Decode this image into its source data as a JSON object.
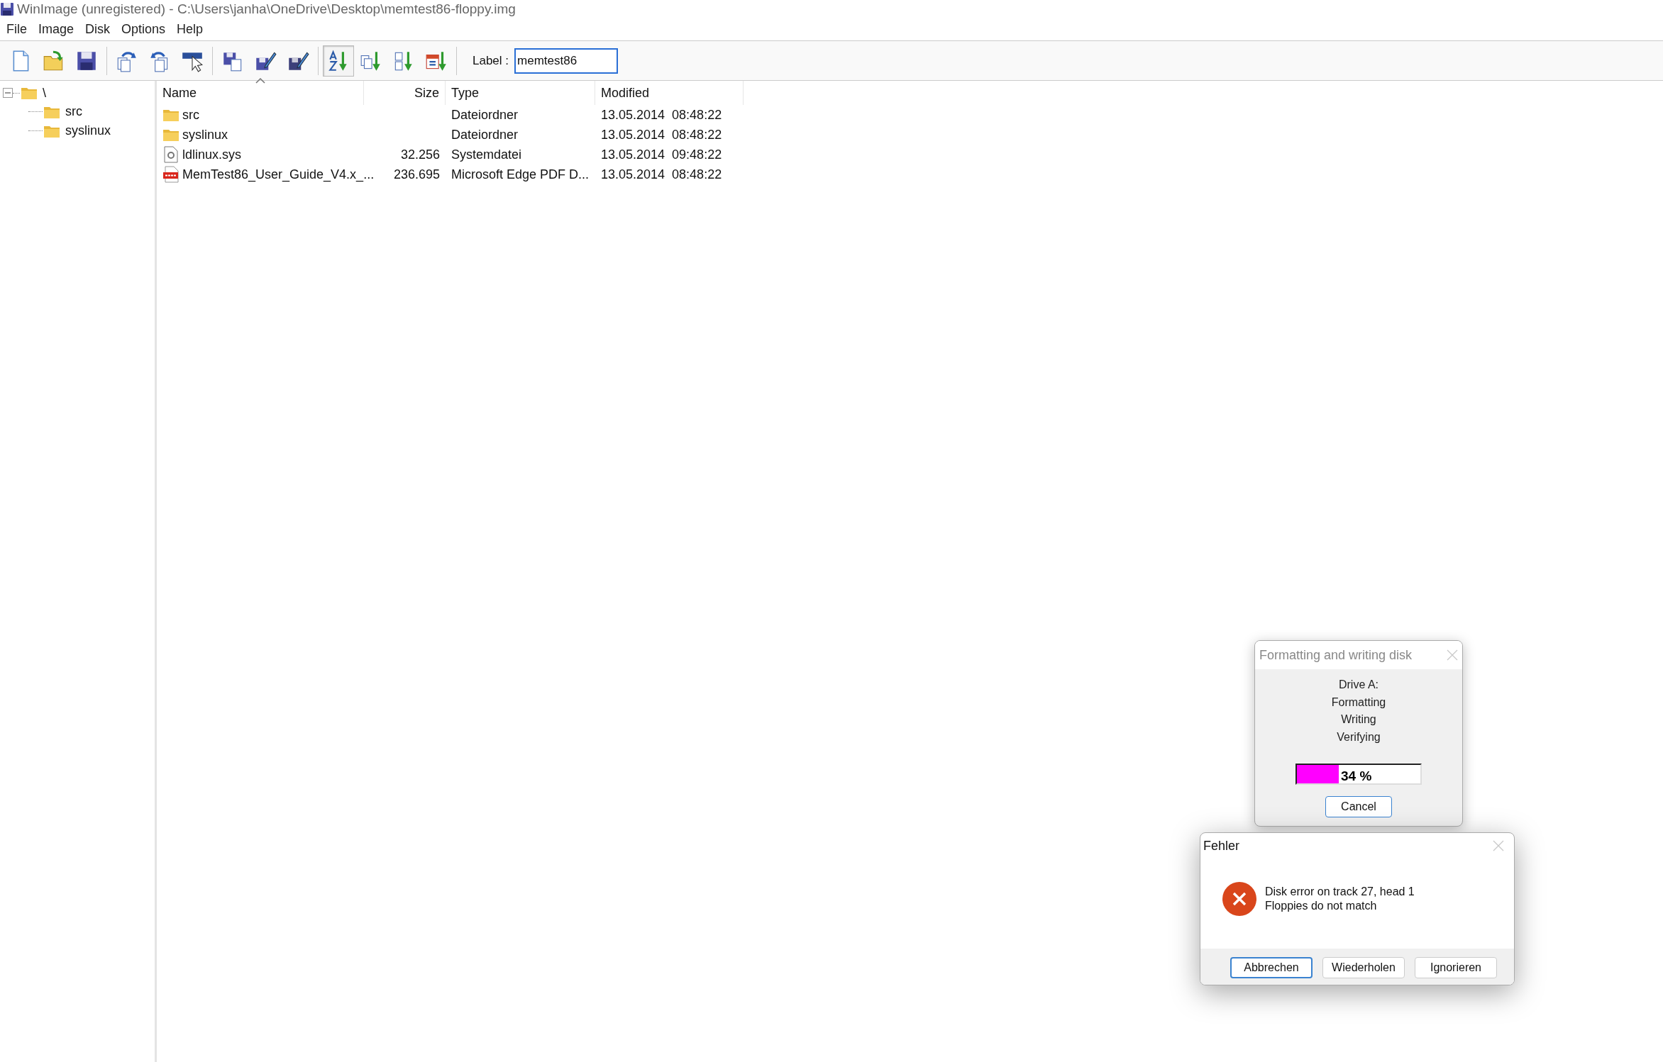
{
  "window": {
    "title": "WinImage (unregistered) - C:\\Users\\janha\\OneDrive\\Desktop\\memtest86-floppy.img"
  },
  "menu": [
    "File",
    "Image",
    "Disk",
    "Options",
    "Help"
  ],
  "toolbar": [
    {
      "kind": "new",
      "pressed": false
    },
    {
      "kind": "open",
      "pressed": false
    },
    {
      "kind": "save",
      "pressed": false
    },
    {
      "kind": "separator"
    },
    {
      "kind": "inject",
      "pressed": false
    },
    {
      "kind": "extract",
      "pressed": false
    },
    {
      "kind": "select",
      "pressed": false
    },
    {
      "kind": "separator"
    },
    {
      "kind": "read",
      "pressed": false
    },
    {
      "kind": "write",
      "pressed": false
    },
    {
      "kind": "format",
      "pressed": false
    },
    {
      "kind": "separator"
    },
    {
      "kind": "sort-name",
      "pressed": true
    },
    {
      "kind": "sort-type",
      "pressed": false
    },
    {
      "kind": "sort-size",
      "pressed": false
    },
    {
      "kind": "sort-date",
      "pressed": false
    },
    {
      "kind": "separator"
    }
  ],
  "label_field": {
    "label": "Label :",
    "value": "memtest86"
  },
  "tree": {
    "label": "\\",
    "expanded": true,
    "children": [
      {
        "label": "src"
      },
      {
        "label": "syslinux"
      }
    ]
  },
  "file_list": {
    "columns": [
      "Name",
      "Size",
      "Type",
      "Modified"
    ],
    "rows": [
      {
        "kind": "folder",
        "name": "src",
        "size": "",
        "type": "Dateiordner",
        "modified": "13.05.2014  08:48:22"
      },
      {
        "kind": "folder",
        "name": "syslinux",
        "size": "",
        "type": "Dateiordner",
        "modified": "13.05.2014  08:48:22"
      },
      {
        "kind": "system",
        "name": "ldlinux.sys",
        "size": "32.256",
        "type": "Systemdatei",
        "modified": "13.05.2014  09:48:22"
      },
      {
        "kind": "pdf",
        "name": "MemTest86_User_Guide_V4.x_...",
        "size": "236.695",
        "type": "Microsoft Edge PDF D...",
        "modified": "13.05.2014  08:48:22"
      }
    ]
  },
  "progress_dialog": {
    "title": "Formatting and writing disk",
    "lines": [
      "Drive A:",
      "Formatting",
      "Writing",
      "Verifying"
    ],
    "progress": {
      "level": 0.34,
      "reading": "34 %"
    },
    "button": "Cancel"
  },
  "error_dialog": {
    "title": "Fehler",
    "message": [
      "Disk error on track 27, head 1",
      "Floppies do not match"
    ],
    "buttons": [
      {
        "label": "Abbrechen",
        "selected": true
      },
      {
        "label": "Wiederholen",
        "selected": false
      },
      {
        "label": "Ignorieren",
        "selected": false
      }
    ]
  }
}
